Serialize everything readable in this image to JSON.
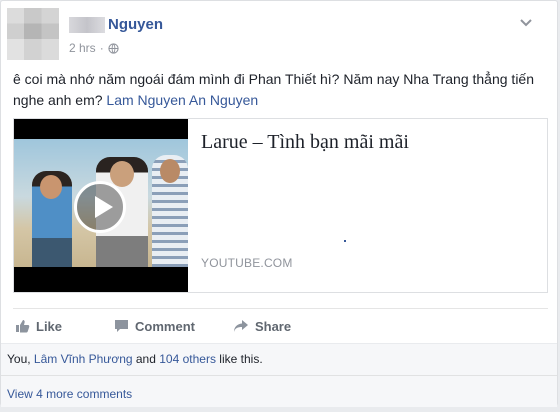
{
  "post": {
    "author": "Nguyen",
    "time": "2 hrs",
    "separator": "·",
    "text_before": "ê coi mà nhớ năm ngoái đám mình đi Phan Thiết hì? Năm nay Nha Trang thẳng tiến nghe anh em? ",
    "mentions": "Lam Nguyen An Nguyen"
  },
  "link": {
    "title": "Larue – Tình bạn mãi mãi",
    "source": "YOUTUBE.COM"
  },
  "actions": {
    "like_label": "Like",
    "comment_label": "Comment",
    "share_label": "Share"
  },
  "likes": {
    "you": "You, ",
    "friend": "Lâm Vĩnh Phương",
    "and": " and ",
    "others": "104 others",
    "suffix": " like this."
  },
  "comments": {
    "view_more": "View 4 more comments"
  },
  "colors": {
    "link_blue": "#365899",
    "meta_gray": "#90949c",
    "action_gray": "#606770"
  }
}
